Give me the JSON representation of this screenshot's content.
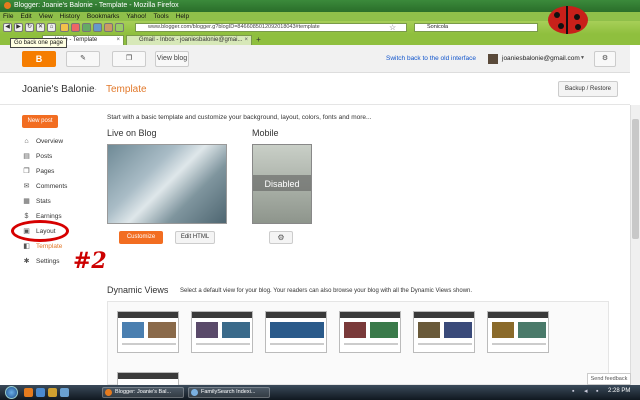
{
  "window": {
    "title": "Blogger: Joanie's Balonie - Template - Mozilla Firefox"
  },
  "menu": [
    "File",
    "Edit",
    "View",
    "History",
    "Bookmarks",
    "Yahoo!",
    "Tools",
    "Help"
  ],
  "browser": {
    "url": "www.blogger.com/blogger.g?blogID=8466085012092018043#template",
    "search_engine_text": "Sonicola",
    "tooltip": "Go back one page"
  },
  "tabs": [
    {
      "label": "Blogger: Joanie's Balonie - Template",
      "visible_label": "lonie - Template",
      "active": true
    },
    {
      "label": "Gmail - Inbox - joaniesbalonie@gmai...",
      "active": false
    }
  ],
  "blogger_header": {
    "logo_text": "B",
    "view_blog": "View blog",
    "old_interface": "Switch back to the old interface",
    "email": "joaniesbalonie@gmail.com"
  },
  "blog": {
    "title": "Joanie's Balonie",
    "page": "Template",
    "separator": "·"
  },
  "backup_restore": "Backup / Restore",
  "sidebar": {
    "new_post": "New post",
    "items": [
      {
        "label": "Overview",
        "icon": "home-icon"
      },
      {
        "label": "Posts",
        "icon": "posts-icon"
      },
      {
        "label": "Pages",
        "icon": "pages-icon"
      },
      {
        "label": "Comments",
        "icon": "comments-icon"
      },
      {
        "label": "Stats",
        "icon": "stats-icon"
      },
      {
        "label": "Earnings",
        "icon": "earnings-icon"
      },
      {
        "label": "Layout",
        "icon": "layout-icon"
      },
      {
        "label": "Template",
        "icon": "template-icon"
      },
      {
        "label": "Settings",
        "icon": "settings-icon"
      }
    ]
  },
  "annotation": {
    "text": "#2",
    "color": "#cc0000"
  },
  "main": {
    "intro": "Start with a basic template and customize your background, layout, colors, fonts and more...",
    "live_label": "Live on Blog",
    "mobile_label": "Mobile",
    "mobile_state": "Disabled",
    "customize": "Customize",
    "edit_html": "Edit HTML"
  },
  "dynamic": {
    "title": "Dynamic Views",
    "desc": "Select a default view for your blog. Your readers can also browse your blog with all the Dynamic Views shown."
  },
  "send_feedback": "Send feedback",
  "taskbar": {
    "tasks": [
      "Blogger: Joanie's Bal...",
      "FamilySearch Indexi..."
    ],
    "clock": "2:28 PM"
  },
  "colors": {
    "accent": "#f26d21",
    "link": "#1155cc",
    "firefox_green": "#8fbf3e"
  }
}
